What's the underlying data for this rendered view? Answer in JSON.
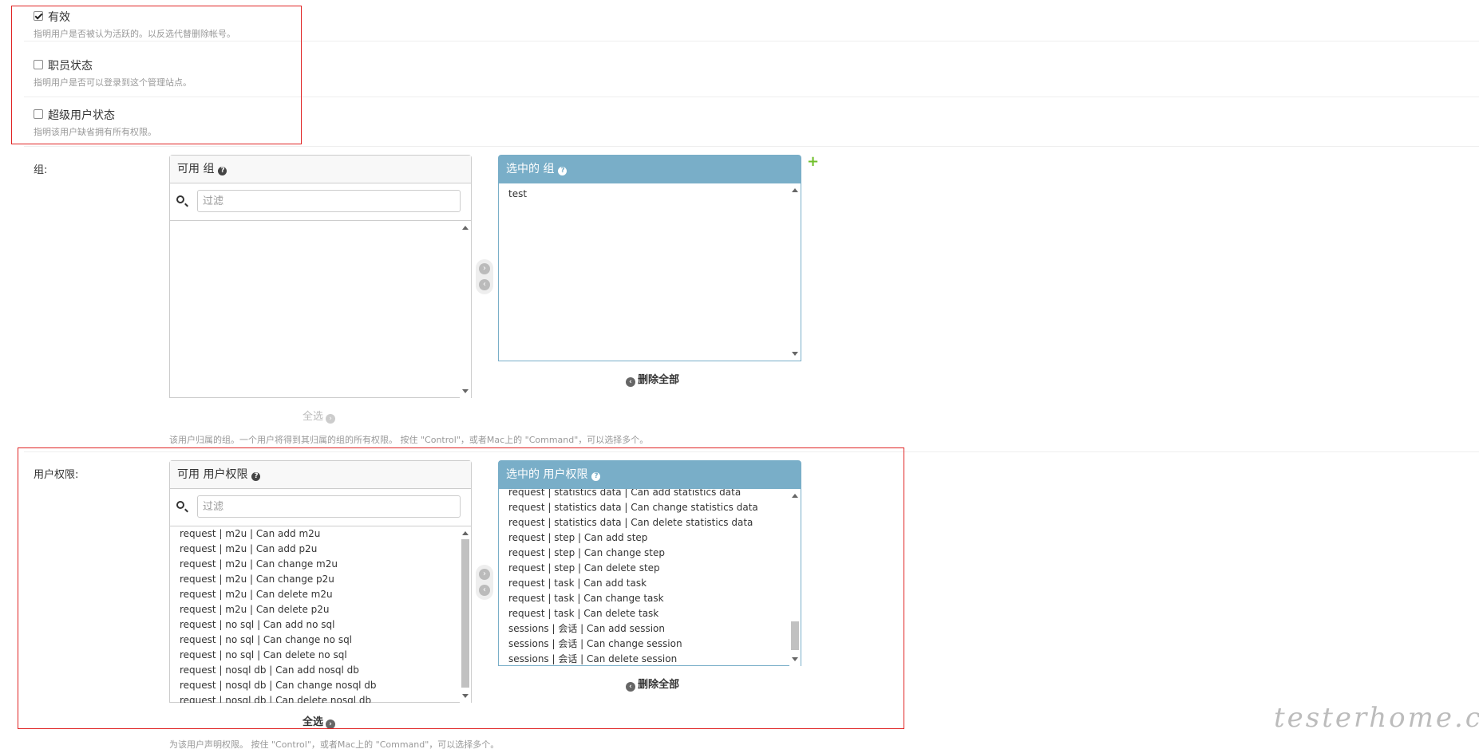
{
  "flags": [
    {
      "label": "有效",
      "help": "指明用户是否被认为活跃的。以反选代替删除帐号。",
      "checked": true
    },
    {
      "label": "职员状态",
      "help": "指明用户是否可以登录到这个管理站点。",
      "checked": false
    },
    {
      "label": "超级用户状态",
      "help": "指明该用户缺省拥有所有权限。",
      "checked": false
    }
  ],
  "groups": {
    "label": "组:",
    "available_title": "可用 组",
    "filter_placeholder": "过滤",
    "available_items": [],
    "chosen_title": "选中的 组",
    "chosen_items": [
      "test"
    ],
    "choose_all": "全选",
    "remove_all": "删除全部",
    "help": "该用户归属的组。一个用户将得到其归属的组的所有权限。 按住 \"Control\"，或者Mac上的 \"Command\"，可以选择多个。"
  },
  "permissions": {
    "label": "用户权限:",
    "available_title": "可用 用户权限",
    "filter_placeholder": "过滤",
    "available_items": [
      "request | m2u | Can add m2u",
      "request | m2u | Can add p2u",
      "request | m2u | Can change m2u",
      "request | m2u | Can change p2u",
      "request | m2u | Can delete m2u",
      "request | m2u | Can delete p2u",
      "request | no sql | Can add no sql",
      "request | no sql | Can change no sql",
      "request | no sql | Can delete no sql",
      "request | nosql db | Can add nosql db",
      "request | nosql db | Can change nosql db",
      "request | nosql db | Can delete nosql db"
    ],
    "chosen_title": "选中的 用户权限",
    "chosen_items": [
      "request | statistics data | Can add statistics data",
      "request | statistics data | Can change statistics data",
      "request | statistics data | Can delete statistics data",
      "request | step | Can add step",
      "request | step | Can change step",
      "request | step | Can delete step",
      "request | task | Can add task",
      "request | task | Can change task",
      "request | task | Can delete task",
      "sessions | 会话 | Can add session",
      "sessions | 会话 | Can change session",
      "sessions | 会话 | Can delete session"
    ],
    "choose_all": "全选",
    "remove_all": "删除全部",
    "help": "为该用户声明权限。 按住 \"Control\"，或者Mac上的 \"Command\"，可以选择多个。"
  },
  "icons": {
    "search": "search-icon",
    "help": "question-circle-icon",
    "add": "plus-icon",
    "move_right": "arrow-right-circle-icon",
    "move_left": "arrow-left-circle-icon"
  },
  "colors": {
    "chosen_header": "#79aec8",
    "highlight_border": "#e02424",
    "add_green": "#70bf2b"
  },
  "watermark": "testerhome.com"
}
